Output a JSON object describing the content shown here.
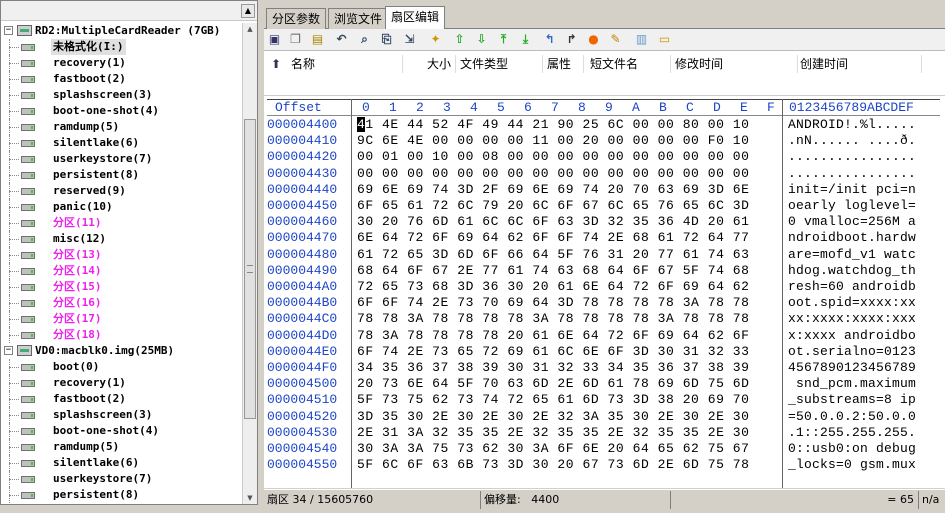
{
  "tree": {
    "root1": "RD2:MultipleCardReader (7GB)",
    "root1_items": [
      "未格式化(I:)",
      "recovery(1)",
      "fastboot(2)",
      "splashscreen(3)",
      "boot-one-shot(4)",
      "ramdump(5)",
      "silentlake(6)",
      "userkeystore(7)",
      "persistent(8)",
      "reserved(9)",
      "panic(10)",
      "分区(11)",
      "misc(12)",
      "分区(13)",
      "分区(14)",
      "分区(15)",
      "分区(16)",
      "分区(17)",
      "分区(18)"
    ],
    "root2": "VD0:macblk0.img(25MB)",
    "root2_items": [
      "boot(0)",
      "recovery(1)",
      "fastboot(2)",
      "splashscreen(3)",
      "boot-one-shot(4)",
      "ramdump(5)",
      "silentlake(6)",
      "userkeystore(7)",
      "persistent(8)"
    ],
    "highlight_color": "#ee22ee"
  },
  "tabs": [
    "分区参数",
    "浏览文件",
    "扇区编辑"
  ],
  "file_header": {
    "up_icon": "up-arrow-icon",
    "columns": [
      "名称",
      "大小",
      "文件类型",
      "属性",
      "短文件名",
      "修改时间",
      "创建时间"
    ]
  },
  "hex": {
    "header_offset": "Offset",
    "header_cols": [
      "0",
      "1",
      "2",
      "3",
      "4",
      "5",
      "6",
      "7",
      "8",
      "9",
      "A",
      "B",
      "C",
      "D",
      "E",
      "F"
    ],
    "header_ascii": "0123456789ABCDEF",
    "rows": [
      {
        "off": "000004400",
        "hex": "41 4E 44 52 4F 49 44 21 90 25 6C 00 00 80 00 10",
        "asc": "ANDROID!.%l....."
      },
      {
        "off": "000004410",
        "hex": "9C 6E 4E 00 00 00 00 11 00 20 00 00 00 00 F0 10",
        "asc": ".nN...... ....ð."
      },
      {
        "off": "000004420",
        "hex": "00 01 00 10 00 08 00 00 00 00 00 00 00 00 00 00",
        "asc": "................"
      },
      {
        "off": "000004430",
        "hex": "00 00 00 00 00 00 00 00 00 00 00 00 00 00 00 00",
        "asc": "................"
      },
      {
        "off": "000004440",
        "hex": "69 6E 69 74 3D 2F 69 6E 69 74 20 70 63 69 3D 6E",
        "asc": "init=/init pci=n"
      },
      {
        "off": "000004450",
        "hex": "6F 65 61 72 6C 79 20 6C 6F 67 6C 65 76 65 6C 3D",
        "asc": "oearly loglevel="
      },
      {
        "off": "000004460",
        "hex": "30 20 76 6D 61 6C 6C 6F 63 3D 32 35 36 4D 20 61",
        "asc": "0 vmalloc=256M a"
      },
      {
        "off": "000004470",
        "hex": "6E 64 72 6F 69 64 62 6F 6F 74 2E 68 61 72 64 77",
        "asc": "ndroidboot.hardw"
      },
      {
        "off": "000004480",
        "hex": "61 72 65 3D 6D 6F 66 64 5F 76 31 20 77 61 74 63",
        "asc": "are=mofd_v1 watc"
      },
      {
        "off": "000004490",
        "hex": "68 64 6F 67 2E 77 61 74 63 68 64 6F 67 5F 74 68",
        "asc": "hdog.watchdog_th"
      },
      {
        "off": "0000044A0",
        "hex": "72 65 73 68 3D 36 30 20 61 6E 64 72 6F 69 64 62",
        "asc": "resh=60 androidb"
      },
      {
        "off": "0000044B0",
        "hex": "6F 6F 74 2E 73 70 69 64 3D 78 78 78 78 3A 78 78",
        "asc": "oot.spid=xxxx:xx"
      },
      {
        "off": "0000044C0",
        "hex": "78 78 3A 78 78 78 78 3A 78 78 78 78 3A 78 78 78",
        "asc": "xx:xxxx:xxxx:xxx"
      },
      {
        "off": "0000044D0",
        "hex": "78 3A 78 78 78 78 20 61 6E 64 72 6F 69 64 62 6F",
        "asc": "x:xxxx androidbo"
      },
      {
        "off": "0000044E0",
        "hex": "6F 74 2E 73 65 72 69 61 6C 6E 6F 3D 30 31 32 33",
        "asc": "ot.serialno=0123"
      },
      {
        "off": "0000044F0",
        "hex": "34 35 36 37 38 39 30 31 32 33 34 35 36 37 38 39",
        "asc": "4567890123456789"
      },
      {
        "off": "000004500",
        "hex": "20 73 6E 64 5F 70 63 6D 2E 6D 61 78 69 6D 75 6D",
        "asc": " snd_pcm.maximum"
      },
      {
        "off": "000004510",
        "hex": "5F 73 75 62 73 74 72 65 61 6D 73 3D 38 20 69 70",
        "asc": "_substreams=8 ip"
      },
      {
        "off": "000004520",
        "hex": "3D 35 30 2E 30 2E 30 2E 32 3A 35 30 2E 30 2E 30",
        "asc": "=50.0.0.2:50.0.0"
      },
      {
        "off": "000004530",
        "hex": "2E 31 3A 32 35 35 2E 32 35 35 2E 32 35 35 2E 30",
        "asc": ".1::255.255.255."
      },
      {
        "off": "000004540",
        "hex": "30 3A 3A 75 73 62 30 3A 6F 6E 20 64 65 62 75 67",
        "asc": "0::usb0:on debug"
      },
      {
        "off": "000004550",
        "hex": "5F 6C 6F 63 6B 73 3D 30 20 67 73 6D 2E 6D 75 78",
        "asc": "_locks=0 gsm.mux"
      }
    ]
  },
  "status": {
    "sector": "扇区 34 / 15605760",
    "offset_label": "偏移量:",
    "offset_value": "4400",
    "value": "= 65",
    "na": "n/a"
  }
}
